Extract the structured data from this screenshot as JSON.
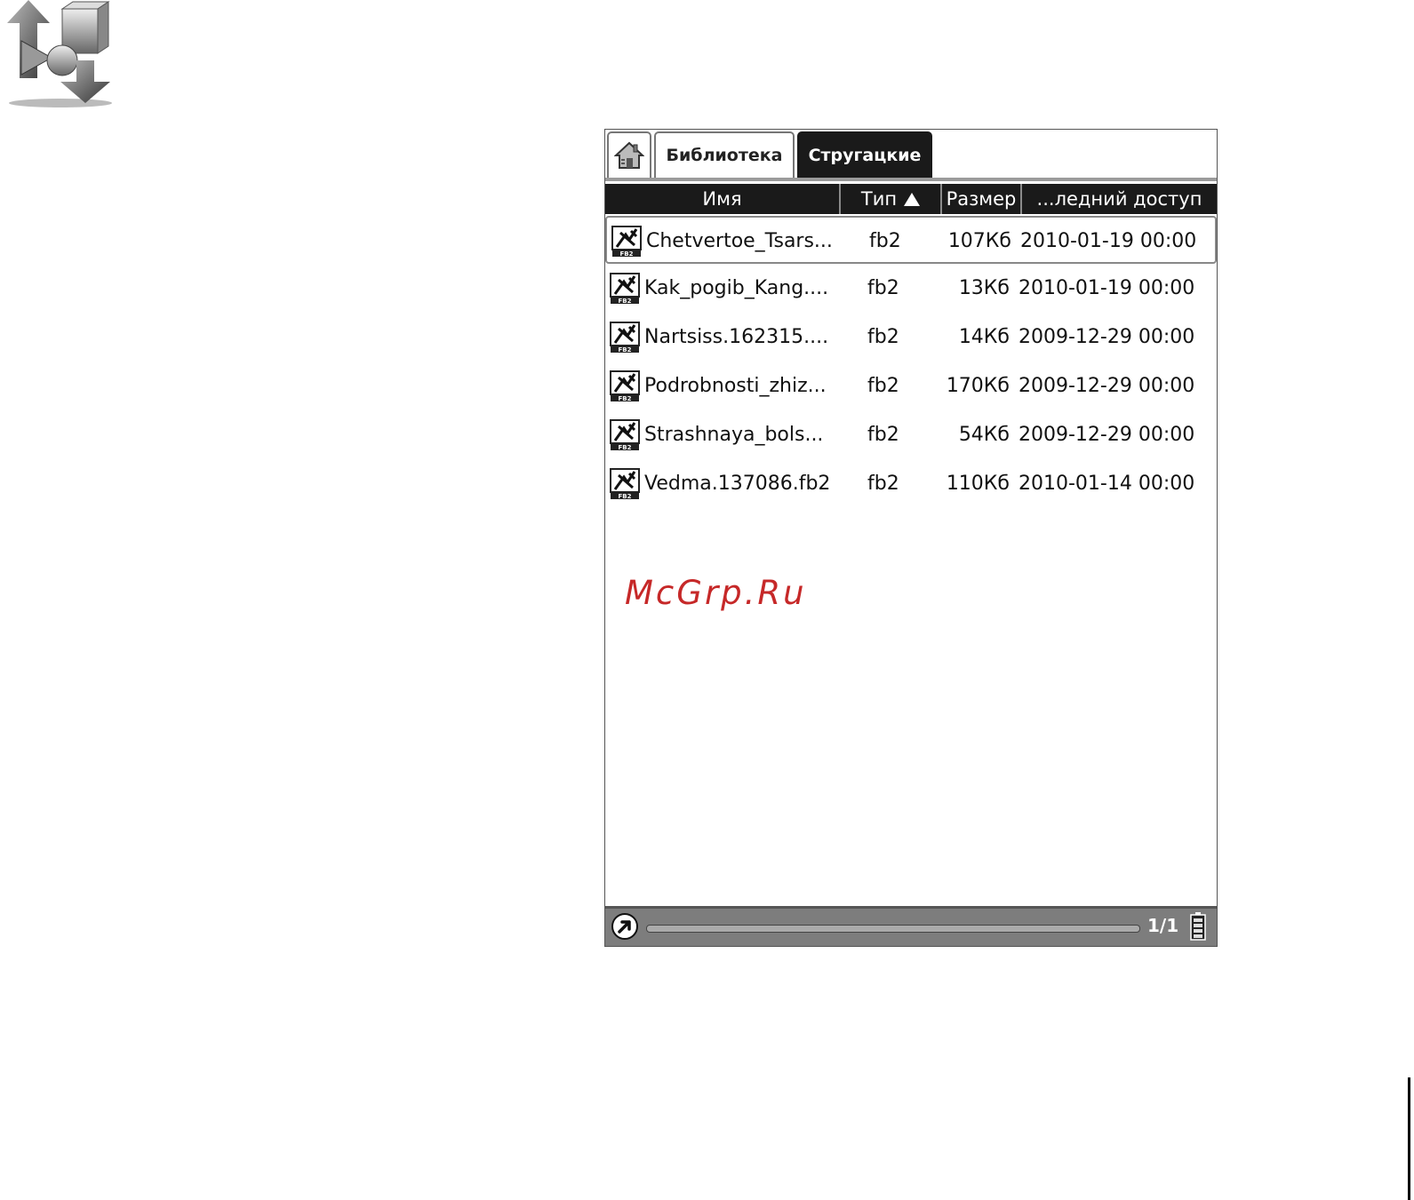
{
  "tabs": {
    "home_icon": "home-icon",
    "library": "Библиотека",
    "current": "Стругацкие"
  },
  "columns": {
    "name": "Имя",
    "type": "Тип",
    "size": "Размер",
    "access": "...ледний доступ",
    "sort_indicator": "ascending"
  },
  "files": [
    {
      "name": "Chetvertoe_Tsars...",
      "type": "fb2",
      "size": "107Кб",
      "access": "2010-01-19 00:00",
      "selected": true
    },
    {
      "name": "Kak_pogib_Kang....",
      "type": "fb2",
      "size": "13Кб",
      "access": "2010-01-19 00:00"
    },
    {
      "name": "Nartsiss.162315....",
      "type": "fb2",
      "size": "14Кб",
      "access": "2009-12-29 00:00"
    },
    {
      "name": "Podrobnosti_zhiz...",
      "type": "fb2",
      "size": "170Кб",
      "access": "2009-12-29 00:00"
    },
    {
      "name": "Strashnaya_bols...",
      "type": "fb2",
      "size": "54Кб",
      "access": "2009-12-29 00:00"
    },
    {
      "name": "Vedma.137086.fb2",
      "type": "fb2",
      "size": "110Кб",
      "access": "2010-01-14 00:00"
    }
  ],
  "watermark": "McGrp.Ru",
  "status": {
    "page": "1/1",
    "back_icon": "back-arrow-icon",
    "battery_icon": "battery-icon"
  },
  "colors": {
    "header_bg": "#1a1a1a",
    "status_bg": "#7d7d7d",
    "watermark": "#c62828"
  }
}
